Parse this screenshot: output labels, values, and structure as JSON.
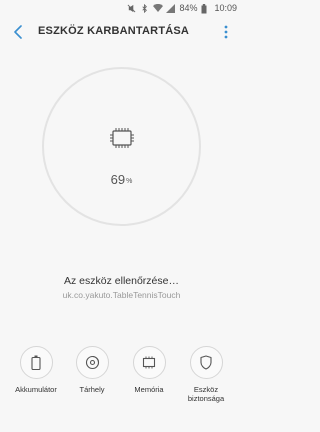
{
  "status_bar": {
    "battery_percent": "84%",
    "time": "10:09"
  },
  "header": {
    "title": "ESZKÖZ KARBANTARTÁSA"
  },
  "score": {
    "value": "69",
    "unit": "%"
  },
  "status": {
    "checking_text": "Az eszköz ellenőrzése…",
    "app_name": "uk.co.yakuto.TableTennisTouch"
  },
  "nav": {
    "items": [
      {
        "label": "Akkumulátor"
      },
      {
        "label": "Tárhely"
      },
      {
        "label": "Memória"
      },
      {
        "label": "Eszköz biztonsága"
      }
    ]
  },
  "colors": {
    "accent": "#3a8fd0",
    "background": "#f7f7f7"
  }
}
